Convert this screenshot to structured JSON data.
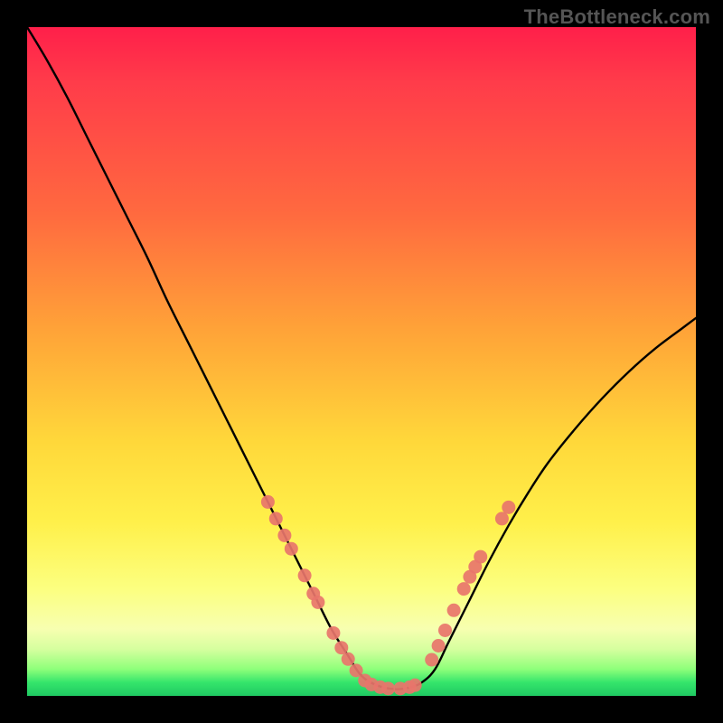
{
  "watermark": "TheBottleneck.com",
  "chart_data": {
    "type": "line",
    "title": "",
    "xlabel": "",
    "ylabel": "",
    "xlim": [
      0,
      100
    ],
    "ylim": [
      0,
      100
    ],
    "series": [
      {
        "name": "bottleneck-curve",
        "x": [
          0,
          3,
          6,
          9,
          12,
          15,
          18,
          21,
          24,
          27,
          30,
          33,
          36,
          38,
          40.5,
          43,
          45.5,
          48,
          50,
          52.5,
          55,
          57,
          59,
          61,
          63,
          66,
          69,
          72,
          75,
          78,
          82,
          86,
          90,
          94,
          98,
          100
        ],
        "y": [
          100,
          95,
          89.5,
          83.5,
          77.5,
          71.5,
          65.5,
          59,
          53,
          47,
          41,
          35,
          29,
          25,
          20,
          15,
          10,
          6,
          3,
          1.5,
          1,
          1.2,
          2,
          4,
          8,
          14,
          20,
          25.5,
          30.5,
          35,
          40,
          44.5,
          48.5,
          52,
          55,
          56.5
        ]
      }
    ],
    "markers": {
      "name": "highlighted-points",
      "color": "#e8756b",
      "points": [
        {
          "x": 36.0,
          "y": 29.0
        },
        {
          "x": 37.2,
          "y": 26.5
        },
        {
          "x": 38.5,
          "y": 24.0
        },
        {
          "x": 39.5,
          "y": 22.0
        },
        {
          "x": 41.5,
          "y": 18.0
        },
        {
          "x": 42.8,
          "y": 15.3
        },
        {
          "x": 43.5,
          "y": 14.0
        },
        {
          "x": 45.8,
          "y": 9.4
        },
        {
          "x": 47.0,
          "y": 7.2
        },
        {
          "x": 48.0,
          "y": 5.5
        },
        {
          "x": 49.2,
          "y": 3.8
        },
        {
          "x": 50.5,
          "y": 2.3
        },
        {
          "x": 51.5,
          "y": 1.7
        },
        {
          "x": 52.8,
          "y": 1.3
        },
        {
          "x": 54.0,
          "y": 1.1
        },
        {
          "x": 55.8,
          "y": 1.1
        },
        {
          "x": 57.2,
          "y": 1.3
        },
        {
          "x": 58.0,
          "y": 1.6
        },
        {
          "x": 60.5,
          "y": 5.4
        },
        {
          "x": 61.5,
          "y": 7.5
        },
        {
          "x": 62.5,
          "y": 9.8
        },
        {
          "x": 63.8,
          "y": 12.8
        },
        {
          "x": 65.3,
          "y": 16.0
        },
        {
          "x": 66.2,
          "y": 17.8
        },
        {
          "x": 67.0,
          "y": 19.3
        },
        {
          "x": 67.8,
          "y": 20.8
        },
        {
          "x": 71.0,
          "y": 26.5
        },
        {
          "x": 72.0,
          "y": 28.2
        }
      ]
    }
  }
}
